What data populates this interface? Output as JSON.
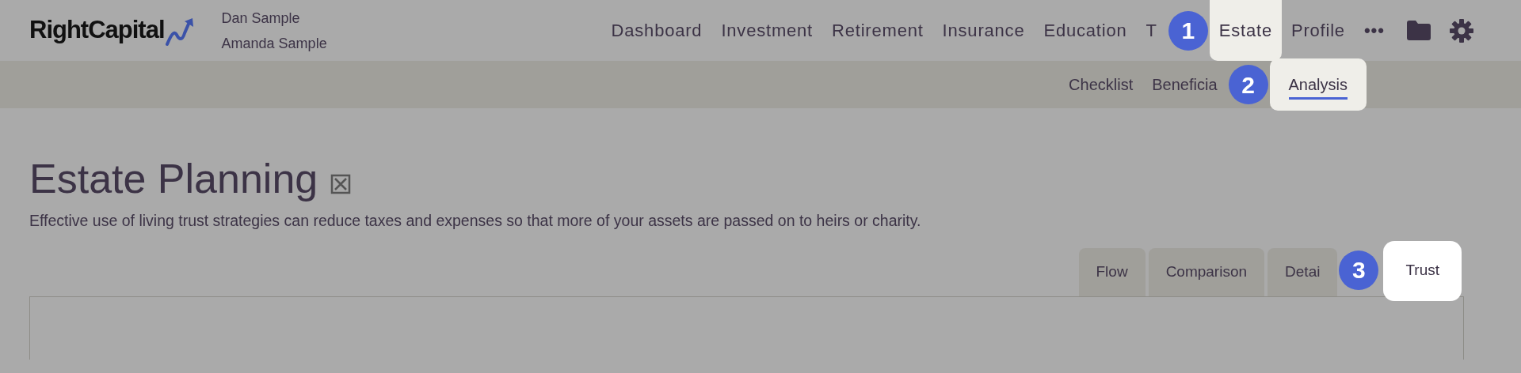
{
  "header": {
    "logo": "RightCapital",
    "clients": [
      "Dan Sample",
      "Amanda Sample"
    ],
    "nav": [
      {
        "label": "Dashboard",
        "selected": false
      },
      {
        "label": "Investment",
        "selected": false
      },
      {
        "label": "Retirement",
        "selected": false
      },
      {
        "label": "Insurance",
        "selected": false
      },
      {
        "label": "Education",
        "selected": false
      },
      {
        "label": "T",
        "selected": false
      },
      {
        "label": "Estate",
        "selected": true,
        "step": "1"
      },
      {
        "label": "Profile",
        "selected": false
      }
    ],
    "more": "•••"
  },
  "subnav": [
    {
      "label": "Checklist",
      "selected": false
    },
    {
      "label": "Beneficia",
      "selected": false
    },
    {
      "label": "Analysis",
      "selected": true,
      "step": "2"
    }
  ],
  "page": {
    "title": "Estate Planning",
    "description": "Effective use of living trust strategies can reduce taxes and expenses so that more of your assets are passed on to heirs or charity."
  },
  "tabs": [
    {
      "label": "Flow",
      "selected": false
    },
    {
      "label": "Comparison",
      "selected": false
    },
    {
      "label": "Detai",
      "selected": false
    },
    {
      "label": "Trust",
      "selected": true,
      "step": "3"
    }
  ]
}
